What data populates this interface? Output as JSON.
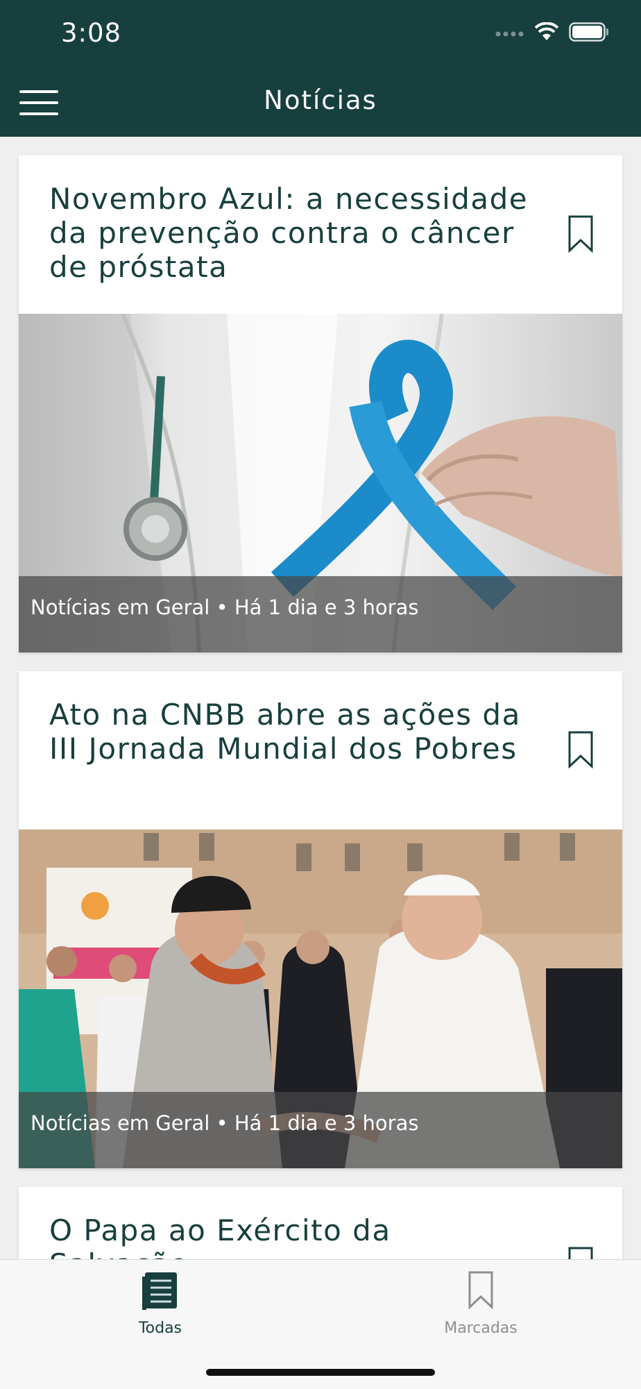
{
  "status_bar": {
    "time": "3:08"
  },
  "nav": {
    "title": "Notícias",
    "menu_icon": "hamburger-icon"
  },
  "colors": {
    "primary": "#173f3d",
    "tab_inactive": "#8e8e8e"
  },
  "articles": [
    {
      "title": "Novembro Azul: a necessidade da prevenção contra o câncer de próstata",
      "category": "Notícias em Geral",
      "time_ago": "Há 1 dia e 3 horas",
      "meta": "Notícias em Geral • Há 1 dia e 3 horas",
      "bookmarked": false,
      "image": "doctor-holding-blue-ribbon"
    },
    {
      "title": "Ato na CNBB abre as ações da III Jornada Mundial dos Pobres",
      "category": "Notícias em Geral",
      "time_ago": "Há 1 dia e 3 horas",
      "meta": "Notícias em Geral • Há 1 dia e 3 horas",
      "bookmarked": false,
      "image": "pope-greeting-elderly-man"
    },
    {
      "title": "O Papa ao Exército da Salvação",
      "bookmarked": false
    }
  ],
  "tabs": [
    {
      "label": "Todas",
      "icon": "news-list-icon",
      "active": true
    },
    {
      "label": "Marcadas",
      "icon": "bookmark-icon",
      "active": false
    }
  ]
}
